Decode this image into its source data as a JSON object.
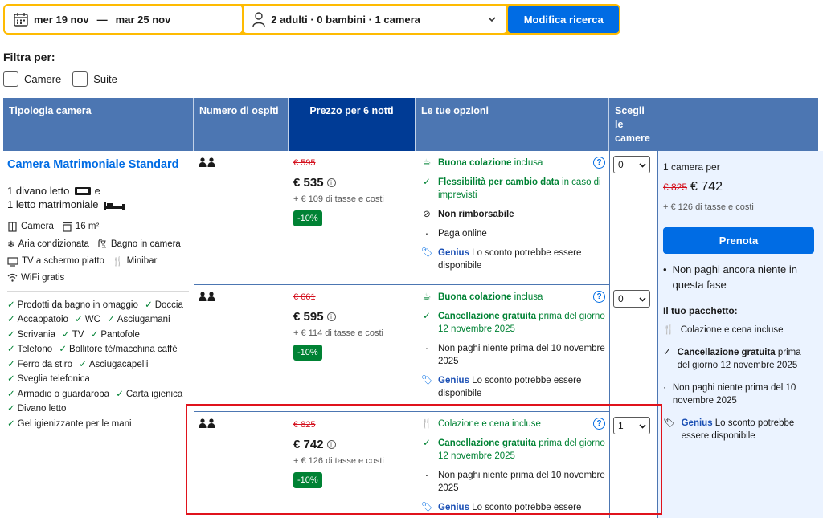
{
  "search": {
    "dates_from": "mer 19 nov",
    "dates_sep": "—",
    "dates_to": "mar 25 nov",
    "guests": "2 adulti · 0 bambini · 1 camera",
    "button": "Modifica ricerca"
  },
  "filters": {
    "title": "Filtra per:",
    "items": [
      {
        "label": "Camere"
      },
      {
        "label": "Suite"
      }
    ]
  },
  "table": {
    "headers": {
      "room_type": "Tipologia camera",
      "guests": "Numero di ospiti",
      "price": "Prezzo per 6 notti",
      "options": "Le tue opzioni",
      "choose": "Scegli le camere"
    }
  },
  "room": {
    "name": "Camera Matrimoniale Standard",
    "bed1": "1 divano letto",
    "bed_join": "e",
    "bed2": "1 letto matrimoniale",
    "facilities": [
      "Camera",
      "16 m²",
      "Aria condizionata",
      "Bagno in camera",
      "TV a schermo piatto",
      "Minibar",
      "WiFi gratis"
    ],
    "amenities": [
      "Prodotti da bagno in omaggio",
      "Doccia",
      "Accappatoio",
      "WC",
      "Asciugamani",
      "Scrivania",
      "TV",
      "Pantofole",
      "Telefono",
      "Bollitore tè/macchina caffè",
      "Ferro da stiro",
      "Asciugacapelli",
      "Sveglia telefonica",
      "Armadio o guardaroba",
      "Carta igienica",
      "Divano letto",
      "Gel igienizzante per le mani"
    ]
  },
  "rates": [
    {
      "old_price": "€ 595",
      "price": "€ 535",
      "taxes": "+ € 109 di tasse e costi",
      "discount": "-10%",
      "meal": "Buona colazione",
      "meal_suffix": " inclusa",
      "opt2_bold": "Flessibilità per cambio data",
      "opt2_rest": " in caso di imprevisti",
      "opt3": "Non rimborsabile",
      "opt4": "Paga online",
      "genius": "Genius",
      "genius_rest": " Lo sconto potrebbe essere disponibile",
      "qty": "0"
    },
    {
      "old_price": "€ 661",
      "price": "€ 595",
      "taxes": "+ € 114 di tasse e costi",
      "discount": "-10%",
      "meal": "Buona colazione",
      "meal_suffix": " inclusa",
      "opt2_bold": "Cancellazione gratuita",
      "opt2_rest": " prima del giorno 12 novembre 2025",
      "opt3": "Non paghi niente prima del 10 novembre 2025",
      "genius": "Genius",
      "genius_rest": " Lo sconto potrebbe essere disponibile",
      "qty": "0"
    },
    {
      "old_price": "€ 825",
      "price": "€ 742",
      "taxes": "+ € 126 di tasse e costi",
      "discount": "-10%",
      "meal": "Colazione e cena incluse",
      "opt2_bold": "Cancellazione gratuita",
      "opt2_rest": " prima del giorno 12 novembre 2025",
      "opt3": "Non paghi niente prima del 10 novembre 2025",
      "genius": "Genius",
      "genius_rest": " Lo sconto potrebbe essere",
      "qty": "1"
    }
  ],
  "summary": {
    "label": "1 camera per",
    "old_price": "€ 825",
    "price": "€ 742",
    "taxes": "+ € 126 di tasse e costi",
    "book": "Prenota",
    "note": "Non paghi ancora niente in questa fase",
    "package_title": "Il tuo pacchetto:",
    "meal": "Colazione e cena incluse",
    "cancel_bold": "Cancellazione gratuita",
    "cancel_rest": " prima del giorno 12 novembre 2025",
    "pay": "Non paghi niente prima del 10 novembre 2025",
    "genius": "Genius",
    "genius_rest": " Lo sconto potrebbe essere disponibile"
  }
}
